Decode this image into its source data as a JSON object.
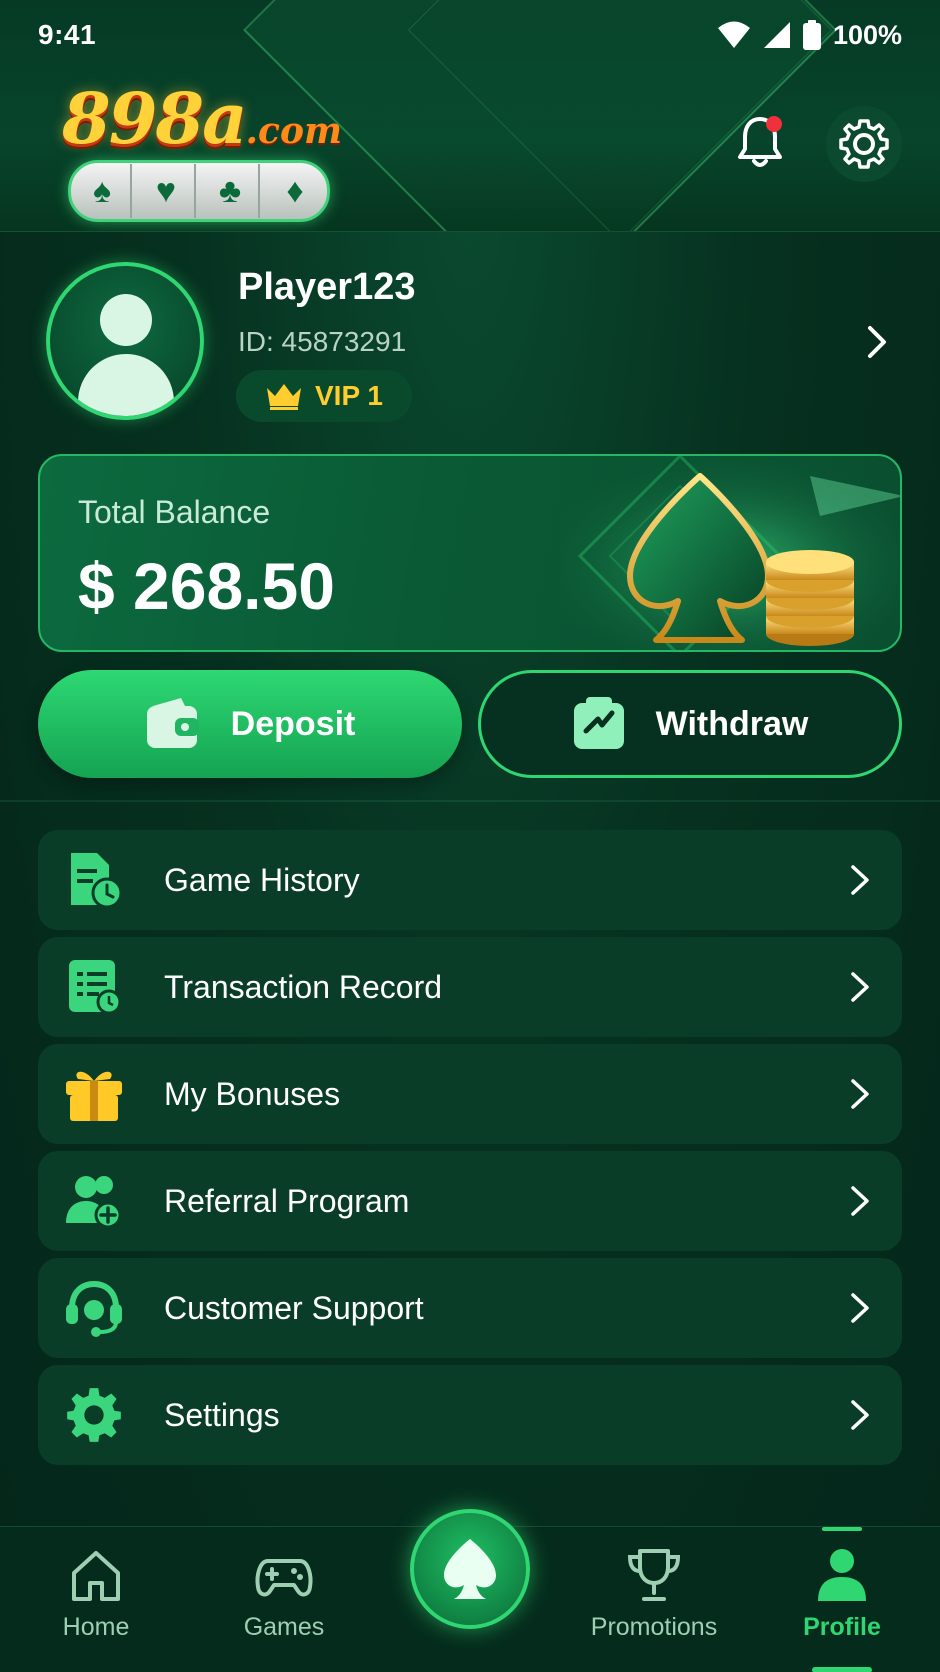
{
  "status_bar": {
    "time": "9:41",
    "battery": "100%"
  },
  "logo": {
    "main": "898a",
    "suffix": ".com"
  },
  "profile": {
    "username": "Player123",
    "id_text": "ID: 45873291",
    "vip_label": "VIP 1"
  },
  "balance": {
    "label": "Total Balance",
    "amount": "$ 268.50"
  },
  "actions": {
    "deposit": "Deposit",
    "withdraw": "Withdraw"
  },
  "menu": [
    {
      "label": "Game History",
      "icon": "document-clock-icon"
    },
    {
      "label": "Transaction Record",
      "icon": "receipt-icon"
    },
    {
      "label": "My Bonuses",
      "icon": "gift-icon"
    },
    {
      "label": "Referral Program",
      "icon": "users-add-icon"
    },
    {
      "label": "Customer Support",
      "icon": "headset-icon"
    },
    {
      "label": "Settings",
      "icon": "gear-icon"
    }
  ],
  "bottom_nav": [
    {
      "label": "Home",
      "icon": "home-icon"
    },
    {
      "label": "Games",
      "icon": "gamepad-icon"
    },
    {
      "label": "",
      "icon": "spade-icon"
    },
    {
      "label": "Promotions",
      "icon": "trophy-icon"
    },
    {
      "label": "Profile",
      "icon": "user-icon",
      "active": true
    }
  ],
  "colors": {
    "accent": "#2fd672",
    "background": "#06301f",
    "vip_gold": "#ffcd2f",
    "notification": "#f0303a"
  }
}
